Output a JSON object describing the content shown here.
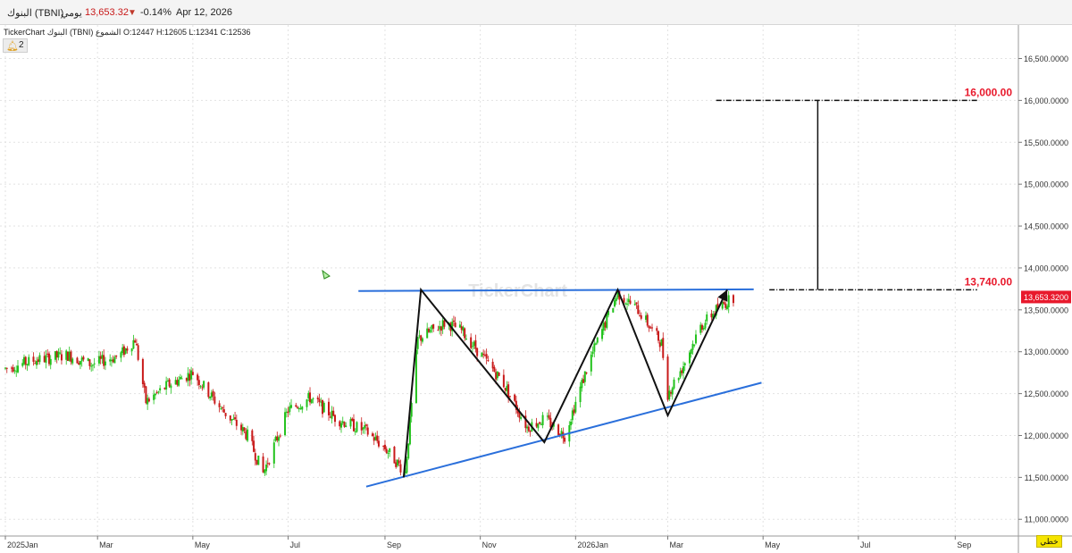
{
  "header": {
    "symbol_name": "البنوك (TBNI)",
    "period": "يومي",
    "last_price": "13,653.32",
    "change_icon": "triangle-down-icon",
    "change_pct": "-0.14%",
    "date": "Apr 12, 2026"
  },
  "info_line": {
    "text": "TickerChart البنوك (TBNI) الشموع  O:12447  H:12605  L:12341  C:12536"
  },
  "alerts": {
    "icon": "bell-icon",
    "count": "2"
  },
  "lang_button": {
    "label": "خطي"
  },
  "watermark": "TickerChart",
  "colors": {
    "up": "#22c21c",
    "down": "#c81a1a",
    "trendline": "#2a6fdb",
    "pattern": "#111111",
    "target_label": "#e8192c",
    "price_tag": "#e8192c"
  },
  "chart_data": {
    "type": "candlestick",
    "title": "",
    "y_axis": {
      "position": "right",
      "min": 10800,
      "max": 16900,
      "ticks": [
        "11,000.0000",
        "11,500.0000",
        "12,000.0000",
        "12,500.0000",
        "13,000.0000",
        "13,500.0000",
        "14,000.0000",
        "14,500.0000",
        "15,000.0000",
        "15,500.0000",
        "16,000.0000",
        "16,500.0000"
      ]
    },
    "x_axis": {
      "start": "2025-01-01",
      "end": "2026-09-30",
      "ticks": [
        {
          "label": "2025Jan",
          "date": "2025-01-01"
        },
        {
          "label": "Mar",
          "date": "2025-03-01"
        },
        {
          "label": "May",
          "date": "2025-05-01"
        },
        {
          "label": "Jul",
          "date": "2025-07-01"
        },
        {
          "label": "Sep",
          "date": "2025-09-01"
        },
        {
          "label": "Nov",
          "date": "2025-11-01"
        },
        {
          "label": "2026Jan",
          "date": "2026-01-01"
        },
        {
          "label": "Mar",
          "date": "2026-03-01"
        },
        {
          "label": "May",
          "date": "2026-05-01"
        },
        {
          "label": "Jul",
          "date": "2026-07-01"
        },
        {
          "label": "Sep",
          "date": "2026-09-01"
        }
      ]
    },
    "grid": true,
    "current_price_tag": "13,653.3200",
    "price_anchors": [
      [
        "2025-01-01",
        12800
      ],
      [
        "2025-01-20",
        12900
      ],
      [
        "2025-02-10",
        12960
      ],
      [
        "2025-02-25",
        12850
      ],
      [
        "2025-03-15",
        12950
      ],
      [
        "2025-03-25",
        13150
      ],
      [
        "2025-04-01",
        12400
      ],
      [
        "2025-04-15",
        12600
      ],
      [
        "2025-05-01",
        12750
      ],
      [
        "2025-05-20",
        12300
      ],
      [
        "2025-06-05",
        12000
      ],
      [
        "2025-06-15",
        11550
      ],
      [
        "2025-07-01",
        12300
      ],
      [
        "2025-07-15",
        12450
      ],
      [
        "2025-08-01",
        12200
      ],
      [
        "2025-08-20",
        12050
      ],
      [
        "2025-09-01",
        11850
      ],
      [
        "2025-09-14",
        11560
      ],
      [
        "2025-09-22",
        13150
      ],
      [
        "2025-10-10",
        13350
      ],
      [
        "2025-10-20",
        13250
      ],
      [
        "2025-11-15",
        12650
      ],
      [
        "2025-12-01",
        12100
      ],
      [
        "2025-12-12",
        12200
      ],
      [
        "2025-12-25",
        12000
      ],
      [
        "2026-01-10",
        12900
      ],
      [
        "2026-01-28",
        13700
      ],
      [
        "2026-02-10",
        13500
      ],
      [
        "2026-02-25",
        13100
      ],
      [
        "2026-03-01",
        12500
      ],
      [
        "2026-03-10",
        12800
      ],
      [
        "2026-03-22",
        13300
      ],
      [
        "2026-04-01",
        13500
      ],
      [
        "2026-04-12",
        13653
      ]
    ],
    "annotations": [
      {
        "type": "line",
        "name": "resistance",
        "color": "blue",
        "points": [
          [
            "2025-08-15",
            13725
          ],
          [
            "2026-04-25",
            13745
          ]
        ]
      },
      {
        "type": "line",
        "name": "support",
        "color": "blue",
        "points": [
          [
            "2025-08-20",
            11390
          ],
          [
            "2026-04-30",
            12630
          ]
        ]
      },
      {
        "type": "polyline",
        "name": "zigzag",
        "color": "black",
        "points": [
          [
            "2025-09-13",
            11500
          ],
          [
            "2025-09-24",
            13740
          ],
          [
            "2025-12-12",
            11920
          ],
          [
            "2026-01-28",
            13740
          ],
          [
            "2026-03-01",
            12240
          ],
          [
            "2026-04-08",
            13740
          ]
        ]
      },
      {
        "type": "level",
        "label": "16,000.00",
        "value": 16000,
        "from": "2026-04-01",
        "to": "2026-09-15"
      },
      {
        "type": "level",
        "label": "13,740.00",
        "value": 13740,
        "from": "2026-05-05",
        "to": "2026-09-15"
      },
      {
        "type": "vertical",
        "from_value": 13740,
        "to_value": 16000,
        "date": "2026-06-05"
      }
    ]
  }
}
